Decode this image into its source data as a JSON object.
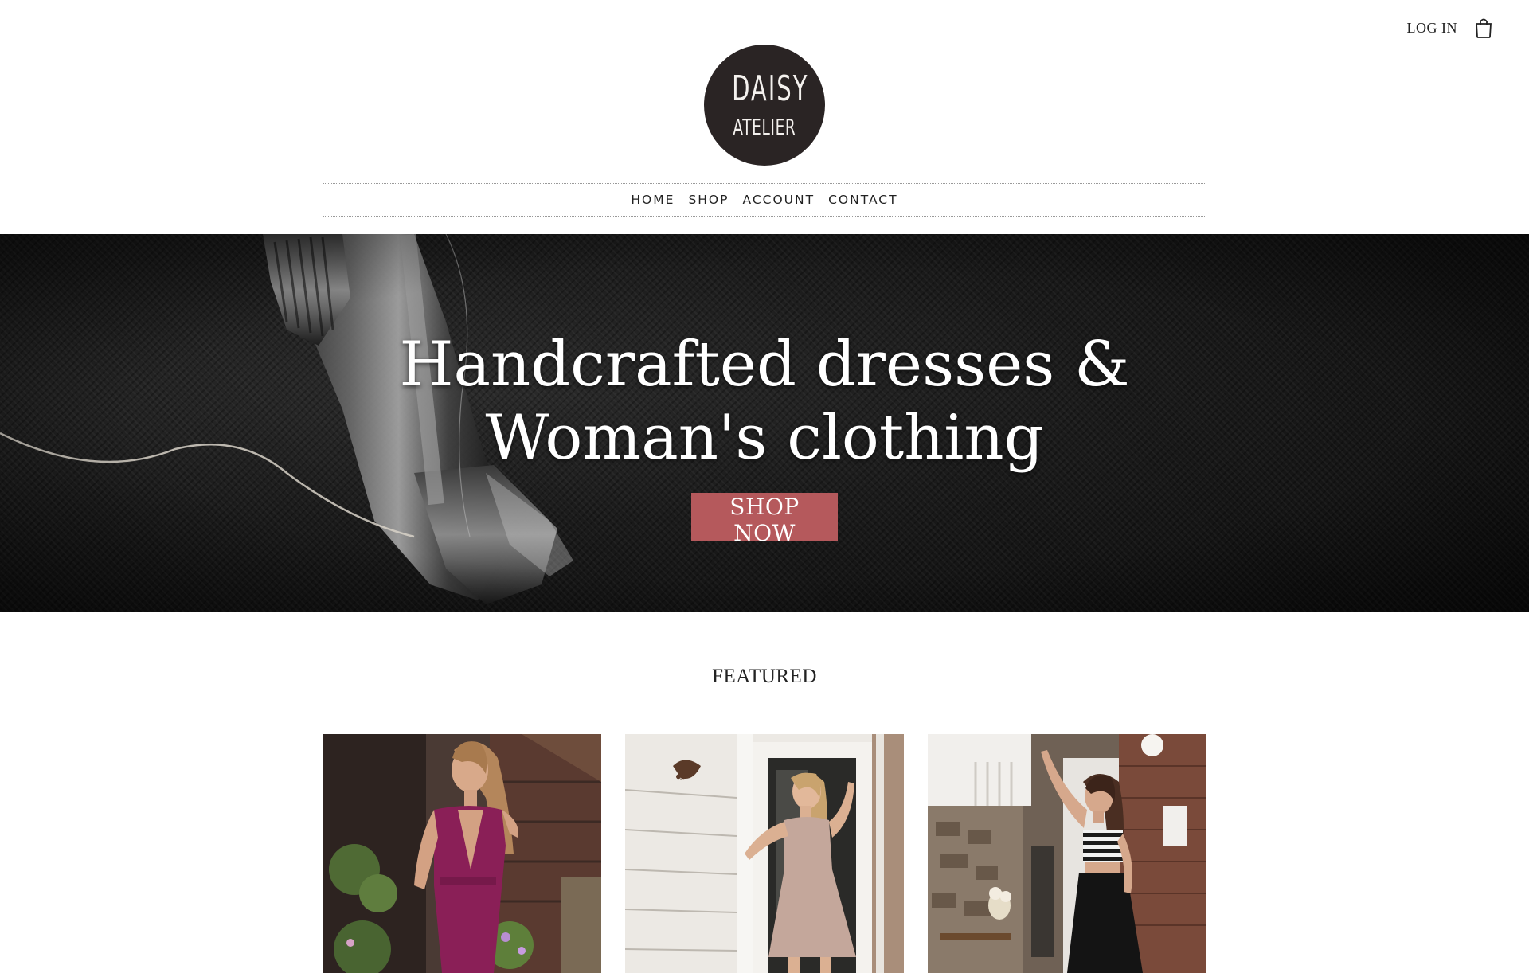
{
  "header": {
    "login_label": "LOG IN",
    "cart_icon": "shopping-bag-icon"
  },
  "logo": {
    "top": "DAISY",
    "bottom": "ATELIER"
  },
  "nav": {
    "items": [
      "HOME",
      "SHOP",
      "ACCOUNT",
      "CONTACT"
    ]
  },
  "hero": {
    "title_line1": "Handcrafted dresses &",
    "title_line2": "Woman's clothing",
    "cta_label": "SHOP NOW",
    "cta_color": "#b5595c"
  },
  "featured": {
    "heading": "FEATURED",
    "products": [
      {
        "image": "woman-in-magenta-dress-photo"
      },
      {
        "image": "woman-in-pink-dress-at-doorway-photo"
      },
      {
        "image": "woman-in-striped-top-and-black-skirt-photo"
      }
    ]
  }
}
